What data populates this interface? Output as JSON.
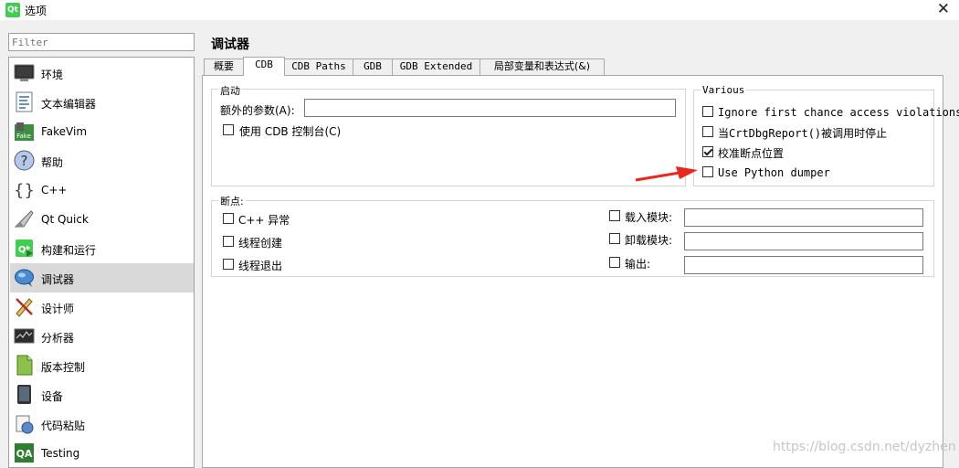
{
  "window": {
    "title": "选项",
    "app_icon_text": "Qt",
    "close_glyph": "✕"
  },
  "filter": {
    "placeholder": "Filter"
  },
  "nav": {
    "items": [
      {
        "label": "环境",
        "icon": "environment-monitor-icon"
      },
      {
        "label": "文本编辑器",
        "icon": "text-editor-icon"
      },
      {
        "label": "FakeVim",
        "icon": "fakevim-icon"
      },
      {
        "label": "帮助",
        "icon": "help-icon"
      },
      {
        "label": "C++",
        "icon": "cpp-braces-icon"
      },
      {
        "label": "Qt Quick",
        "icon": "qt-quick-icon"
      },
      {
        "label": "构建和运行",
        "icon": "build-run-icon"
      },
      {
        "label": "调试器",
        "icon": "debugger-icon",
        "selected": true
      },
      {
        "label": "设计师",
        "icon": "designer-icon"
      },
      {
        "label": "分析器",
        "icon": "analyzer-icon"
      },
      {
        "label": "版本控制",
        "icon": "version-control-icon"
      },
      {
        "label": "设备",
        "icon": "device-icon"
      },
      {
        "label": "代码粘贴",
        "icon": "code-paste-icon"
      },
      {
        "label": "Testing",
        "icon": "testing-qa-icon"
      }
    ]
  },
  "page": {
    "title": "调试器"
  },
  "tabs": [
    {
      "label": "概要"
    },
    {
      "label": "CDB",
      "active": true
    },
    {
      "label": "CDB Paths"
    },
    {
      "label": "GDB"
    },
    {
      "label": "GDB Extended"
    },
    {
      "label": "局部变量和表达式(&)"
    }
  ],
  "startup": {
    "title": "启动",
    "extra_args_label": "额外的参数(A):",
    "extra_args_value": "",
    "use_console_label": "使用 CDB 控制台(C)",
    "use_console_checked": false
  },
  "various": {
    "title": "Various",
    "options": [
      {
        "label": "Ignore first chance access violations",
        "checked": false
      },
      {
        "label": "当CrtDbgReport()被调用时停止",
        "checked": false
      },
      {
        "label": "校准断点位置",
        "checked": true
      },
      {
        "label": "Use Python dumper",
        "checked": false
      }
    ]
  },
  "breakpoints": {
    "title": "断点:",
    "left": [
      {
        "label": "C++ 异常",
        "checked": false
      },
      {
        "label": "线程创建",
        "checked": false
      },
      {
        "label": "线程退出",
        "checked": false
      }
    ],
    "right": [
      {
        "label": "载入模块:",
        "checked": false,
        "value": ""
      },
      {
        "label": "卸载模块:",
        "checked": false,
        "value": ""
      },
      {
        "label": "输出:",
        "checked": false,
        "value": ""
      }
    ]
  },
  "annotation": {
    "arrow_color": "#e8281e"
  },
  "watermark": {
    "text": "https://blog.csdn.net/dyzhen"
  }
}
